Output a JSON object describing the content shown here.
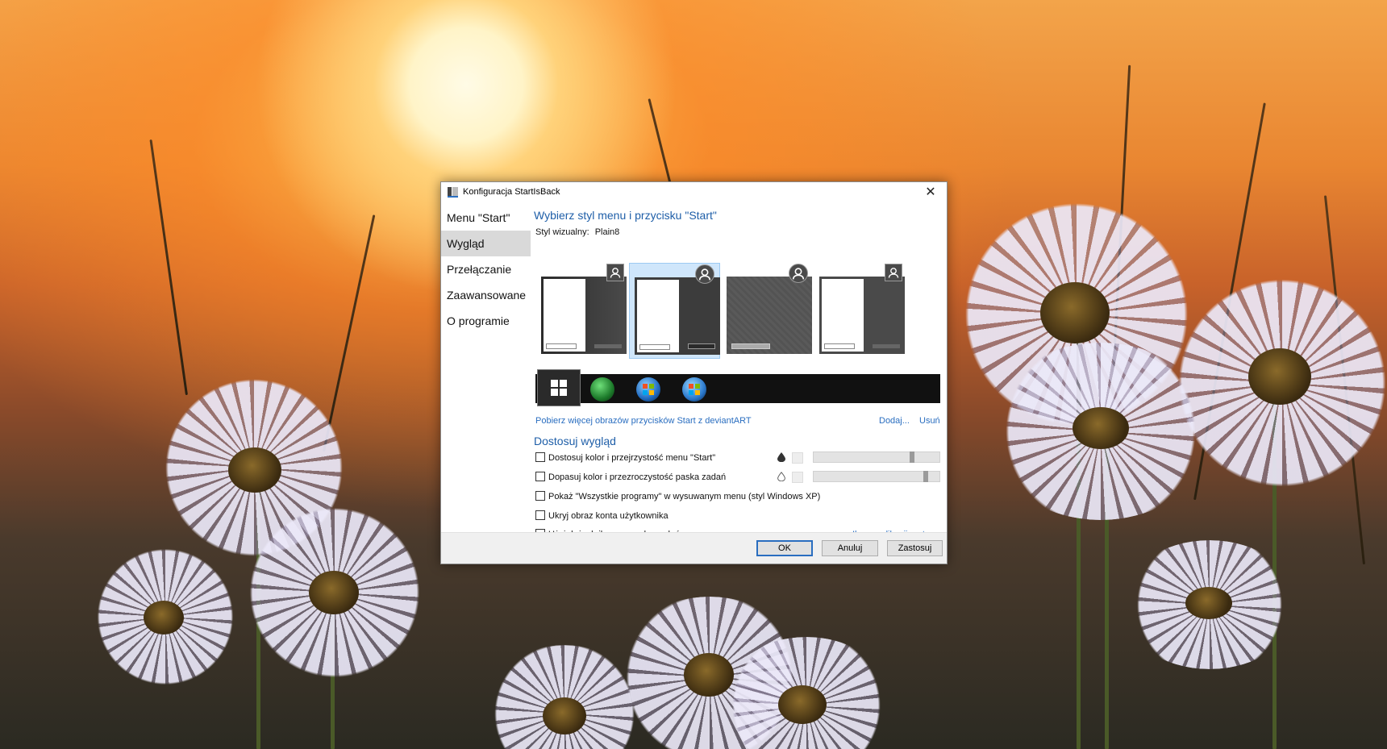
{
  "window": {
    "title": "Konfiguracja StartIsBack",
    "close_glyph": "✕"
  },
  "nav": {
    "items": [
      {
        "label": "Menu \"Start\""
      },
      {
        "label": "Wygląd"
      },
      {
        "label": "Przełączanie"
      },
      {
        "label": "Zaawansowane"
      },
      {
        "label": "O programie"
      }
    ],
    "selected": "Wygląd"
  },
  "appearance": {
    "heading": "Wybierz styl menu i przycisku \"Start\"",
    "visual_style_label": "Styl wizualny:",
    "visual_style_value": "Plain8",
    "styles_selected_index": 1,
    "download_link": "Pobierz więcej obrazów przycisków Start z deviantART",
    "add_link": "Dodaj...",
    "remove_link": "Usuń"
  },
  "customize": {
    "heading": "Dostosuj wygląd",
    "options": [
      {
        "label": "Dostosuj kolor i przejrzystość menu \"Start\"",
        "checked": false
      },
      {
        "label": "Dopasuj kolor i przezroczystość paska zadań",
        "checked": false
      },
      {
        "label": "Pokaż \"Wszystkie programy\" w wysuwanym menu (styl Windows XP)",
        "checked": false
      },
      {
        "label": "Ukryj obraz konta użytkownika",
        "checked": false
      },
      {
        "label": "Użyj dużych ikon na pasku zadań",
        "checked": false
      }
    ],
    "metro_link": "Ikony aplikacji metro...",
    "menu_transparency": 0.72,
    "taskbar_transparency": 0.85
  },
  "buttons": {
    "ok": "OK",
    "cancel": "Anuluj",
    "apply": "Zastosuj"
  },
  "colors": {
    "accent": "#2a6ec0",
    "heading": "#1e5ea8",
    "selected_nav": "#d9d9d9",
    "selected_thumb": "#cfe6fb"
  }
}
